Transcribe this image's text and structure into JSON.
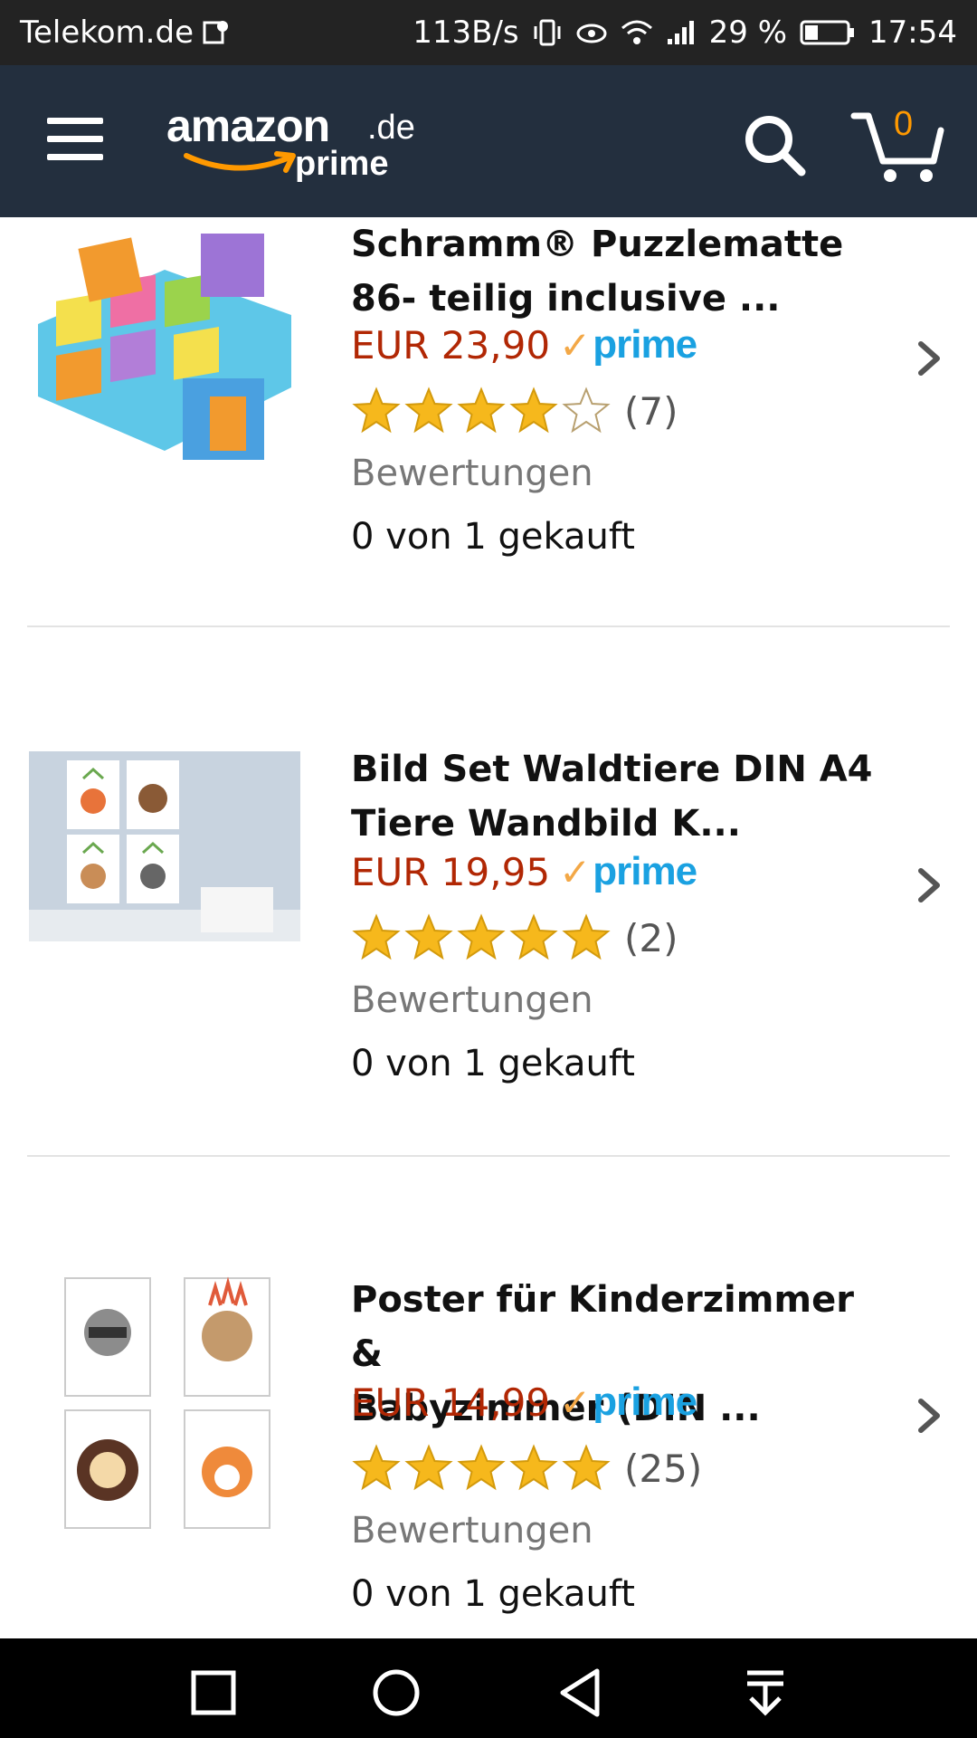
{
  "status_bar": {
    "carrier": "Telekom.de",
    "speed": "113B/s",
    "battery": "29 %",
    "time": "17:54"
  },
  "header": {
    "logo_text": "amazon",
    "logo_domain": ".de",
    "logo_sub": "prime",
    "cart_count": "0"
  },
  "colors": {
    "header_bg": "#232f3e",
    "price": "#b12704",
    "prime": "#1aa1e1",
    "star": "#f6b81c",
    "accent": "#ff9900"
  },
  "products": [
    {
      "title_line1": "Schramm® Puzzlematte",
      "title_line2": "86- teilig inclusive ...",
      "price": "EUR 23,90",
      "prime": "prime",
      "rating_stars": 4,
      "review_count": "(7)",
      "reviews_label": "Bewertungen",
      "bought": "0 von 1 gekauft"
    },
    {
      "title_line1": "Bild Set Waldtiere DIN A4",
      "title_line2": "Tiere Wandbild K...",
      "price": "EUR 19,95",
      "prime": "prime",
      "rating_stars": 5,
      "review_count": "(2)",
      "reviews_label": "Bewertungen",
      "bought": "0 von 1 gekauft"
    },
    {
      "title_line1": "Poster für Kinderzimmer &",
      "title_line2": "Babyzimmer (DIN ...",
      "price": "EUR 14,99",
      "prime": "prime",
      "rating_stars": 5,
      "review_count": "(25)",
      "reviews_label": "Bewertungen",
      "bought": "0 von 1 gekauft"
    }
  ],
  "nav_icons": [
    "recents-icon",
    "home-icon",
    "back-icon",
    "notification-pull-icon"
  ]
}
